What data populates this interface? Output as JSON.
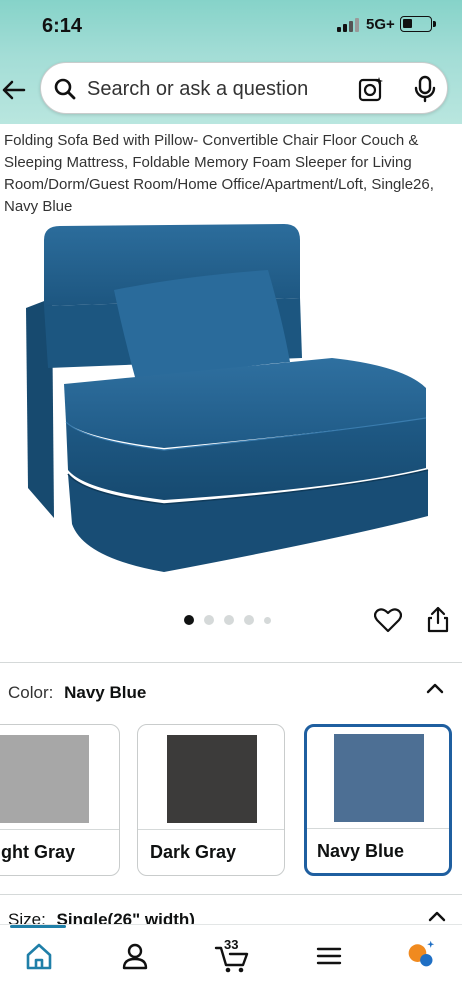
{
  "status_bar": {
    "time": "6:14",
    "network": "5G+"
  },
  "search": {
    "placeholder": "Search or ask a question"
  },
  "product": {
    "title": "Folding Sofa Bed with Pillow- Convertible Chair Floor Couch & Sleeping Mattress, Foldable Memory Foam Sleeper for Living Room/Dorm/Guest Room/Home Office/Apartment/Loft, Single26, Navy Blue",
    "image_count": 5,
    "image_index": 1
  },
  "color": {
    "label": "Color:",
    "value": "Navy Blue",
    "options": [
      {
        "name": "ght Gray",
        "swatch": "#a7a7a7",
        "selected": false
      },
      {
        "name": "Dark Gray",
        "swatch": "#3c3b3a",
        "selected": false
      },
      {
        "name": "Navy Blue",
        "swatch": "#4d6f94",
        "selected": true
      }
    ]
  },
  "size": {
    "label": "Size:",
    "value": "Single(26\" width)"
  },
  "bottom_nav": {
    "items": [
      "home-icon",
      "account-icon",
      "cart-icon",
      "menu-icon",
      "rufus-icon"
    ],
    "cart_count": "33",
    "active": "home-icon"
  },
  "colors": {
    "accent": "#1f5fa0",
    "product": "#1e5a86",
    "header": "#a3ddd6"
  }
}
